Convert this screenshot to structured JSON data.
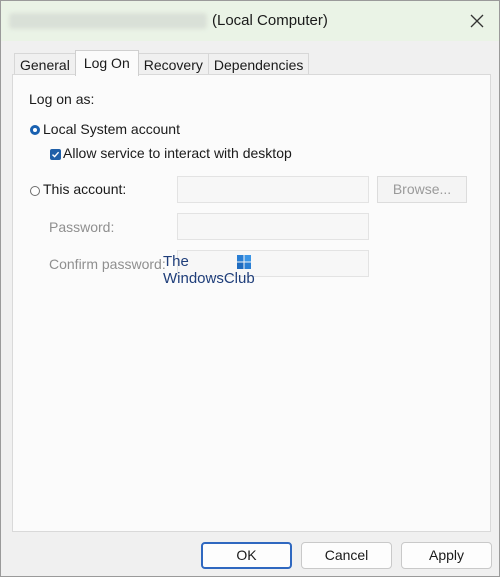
{
  "window": {
    "title_suffix": "(Local Computer)"
  },
  "tabs": [
    {
      "label": "General"
    },
    {
      "label": "Log On"
    },
    {
      "label": "Recovery"
    },
    {
      "label": "Dependencies"
    }
  ],
  "logon": {
    "heading": "Log on as:",
    "local_system_label": "Local System account",
    "local_system_selected": true,
    "interact_label": "Allow service to interact with desktop",
    "interact_checked": true,
    "this_account_label": "This account:",
    "this_account_value": "",
    "browse_label": "Browse...",
    "password_label": "Password:",
    "password_value": "",
    "confirm_label": "Confirm password:",
    "confirm_value": ""
  },
  "watermark": {
    "line1": "The",
    "line2": "WindowsClub"
  },
  "buttons": {
    "ok": "OK",
    "cancel": "Cancel",
    "apply": "Apply"
  },
  "colors": {
    "accent": "#1f5fa8",
    "titlebar": "#eaf3e6"
  }
}
